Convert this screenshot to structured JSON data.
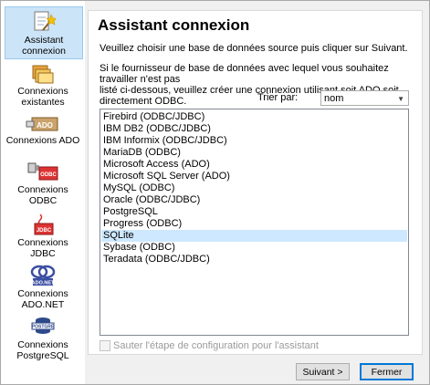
{
  "sidebar": {
    "items": [
      {
        "label_1": "Assistant",
        "label_2": "connexion",
        "icon": "wizard-icon"
      },
      {
        "label_1": "Connexions",
        "label_2": "existantes",
        "icon": "existing-connections-icon"
      },
      {
        "label_1": "Connexions ADO",
        "label_2": "",
        "icon": "ado-icon"
      },
      {
        "label_1": "Connexions",
        "label_2": "ODBC",
        "icon": "odbc-icon"
      },
      {
        "label_1": "Connexions",
        "label_2": "JDBC",
        "icon": "jdbc-icon"
      },
      {
        "label_1": "Connexions",
        "label_2": "ADO.NET",
        "icon": "adonet-icon"
      },
      {
        "label_1": "Connexions",
        "label_2": "PostgreSQL",
        "icon": "postgresql-icon"
      }
    ]
  },
  "main": {
    "title": "Assistant connexion",
    "instruction": "Veuillez choisir une base de données source puis cliquer sur Suivant.",
    "help_line1": "Si le fournisseur de base de données avec lequel vous souhaitez travailler n'est pas",
    "help_line2": "listé ci-dessous, veuillez créer une connexion utilisant soit ADO soit directement ODBC.",
    "sort_label": "Trier par:",
    "sort_value": "nom",
    "databases": [
      "Firebird (ODBC/JDBC)",
      "IBM DB2 (ODBC/JDBC)",
      "IBM Informix (ODBC/JDBC)",
      "MariaDB (ODBC)",
      "Microsoft Access (ADO)",
      "Microsoft SQL Server (ADO)",
      "MySQL (ODBC)",
      "Oracle (ODBC/JDBC)",
      "PostgreSQL",
      "Progress (ODBC)",
      "SQLite",
      "Sybase (ODBC)",
      "Teradata (ODBC/JDBC)"
    ],
    "selected_database": "SQLite",
    "skip_label": "Sauter l'étape de configuration pour l'assistant"
  },
  "buttons": {
    "next": "Suivant >",
    "close": "Fermer"
  },
  "colors": {
    "selection": "#cde8ff",
    "sidebar_selection": "#cce4f7",
    "default_button_border": "#0078d7"
  }
}
